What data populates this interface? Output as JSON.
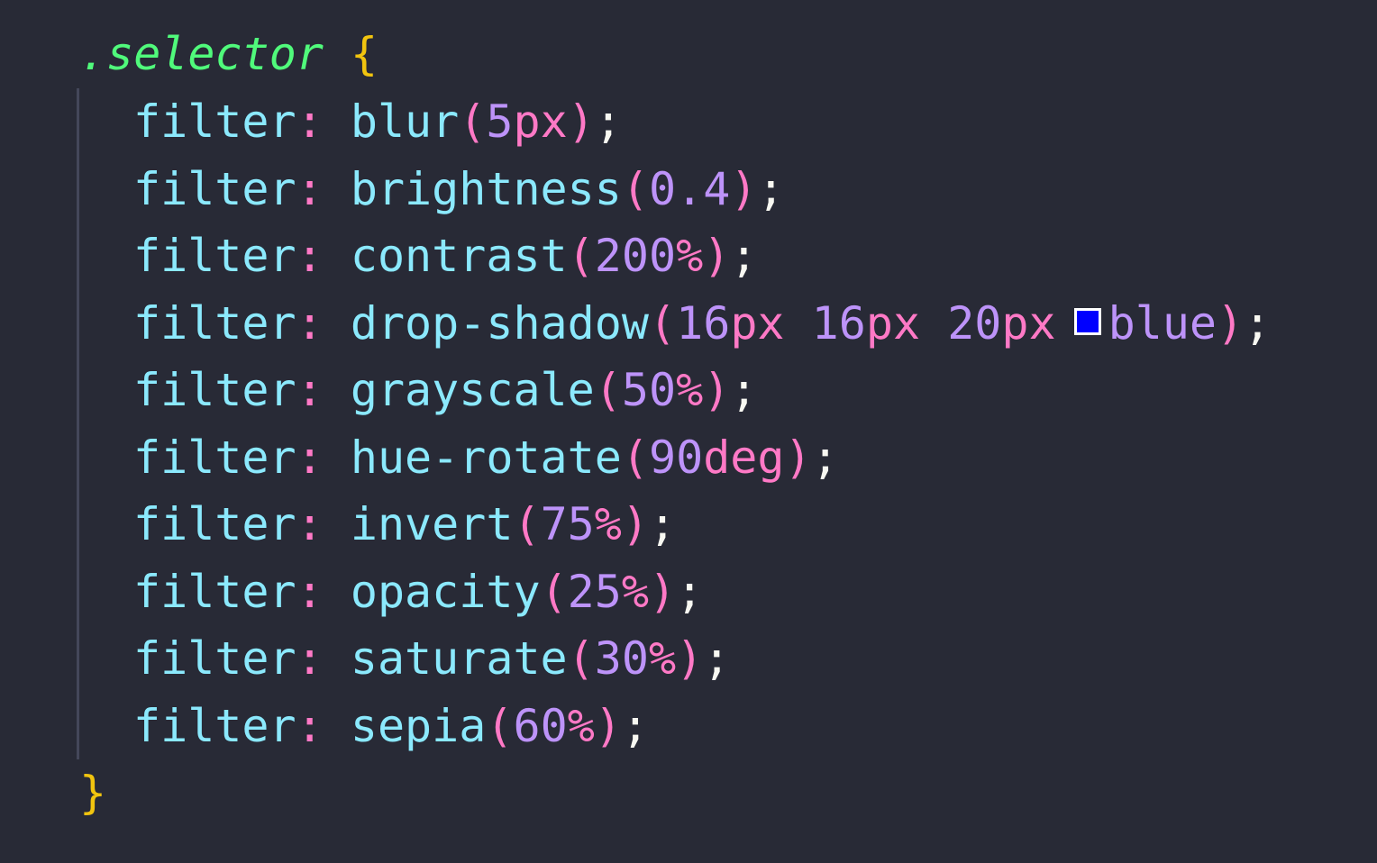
{
  "selector": ".selector",
  "open_brace": "{",
  "close_brace": "}",
  "colors": {
    "background": "#282a36",
    "selector": "#50fa7b",
    "brace": "#f1c40f",
    "property": "#8be9fd",
    "punctuation": "#ff79c6",
    "number": "#bd93f9",
    "swatch": "#0000ff"
  },
  "lines": [
    {
      "prop": "filter",
      "func": "blur",
      "num": "5",
      "unit": "px"
    },
    {
      "prop": "filter",
      "func": "brightness",
      "num": "0.4",
      "unit": ""
    },
    {
      "prop": "filter",
      "func": "contrast",
      "num": "200",
      "unit": "%"
    },
    {
      "prop": "filter",
      "func": "drop-shadow",
      "a": "16",
      "b": "16",
      "c": "20",
      "unit": "px",
      "color_kw": "blue"
    },
    {
      "prop": "filter",
      "func": "grayscale",
      "num": "50",
      "unit": "%"
    },
    {
      "prop": "filter",
      "func": "hue-rotate",
      "num": "90",
      "unit": "deg"
    },
    {
      "prop": "filter",
      "func": "invert",
      "num": "75",
      "unit": "%"
    },
    {
      "prop": "filter",
      "func": "opacity",
      "num": "25",
      "unit": "%"
    },
    {
      "prop": "filter",
      "func": "saturate",
      "num": "30",
      "unit": "%"
    },
    {
      "prop": "filter",
      "func": "sepia",
      "num": "60",
      "unit": "%"
    }
  ]
}
